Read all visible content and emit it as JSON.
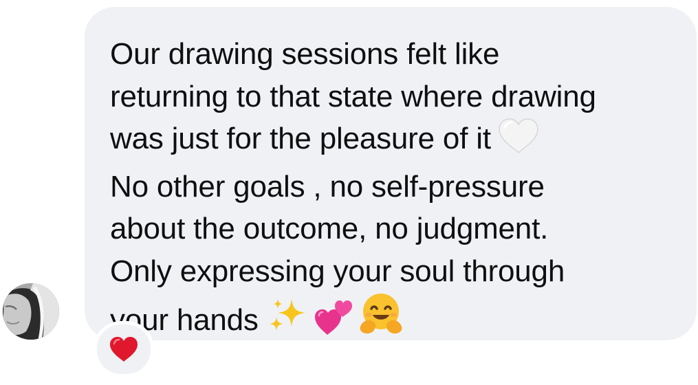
{
  "conversation": {
    "sender": {
      "avatar_icon": "profile-photo"
    },
    "message": {
      "lines": [
        "Our drawing sessions felt like",
        "returning to that state where drawing",
        "was just for the pleasure of it",
        "No other goals , no self-pressure",
        "about the outcome, no judgment.",
        "Only expressing your soul through",
        "your hands"
      ],
      "inline_emojis": {
        "line_3": "white-heart-icon",
        "line_7": [
          "sparkles-icon",
          "two-hearts-icon",
          "hugging-face-icon"
        ]
      },
      "bubble_color": "#eff1f4",
      "text_color": "#0f0f10"
    },
    "reaction": {
      "icon": "red-heart-icon",
      "color": "#e0182d"
    }
  }
}
